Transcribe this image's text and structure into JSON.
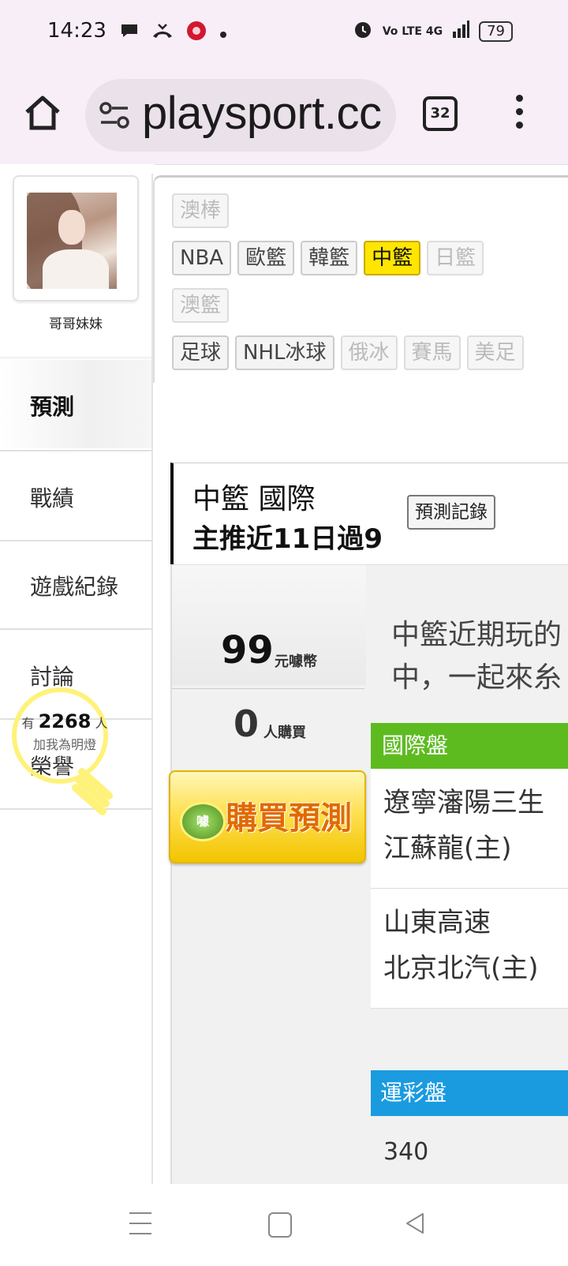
{
  "status": {
    "time": "14:23",
    "signal": "Vo LTE 4G",
    "battery": "79"
  },
  "browser": {
    "url": "playsport.cc",
    "tab_count": "32"
  },
  "user": {
    "name": "哥哥妹妹"
  },
  "nav": [
    {
      "label": "預測",
      "active": true
    },
    {
      "label": "戰績"
    },
    {
      "label": "遊戲紀錄"
    },
    {
      "label": "討論"
    },
    {
      "label": "榮譽"
    }
  ],
  "fans": {
    "prefix": "有",
    "count": "2268",
    "suffix": "人",
    "label": "加我為明燈"
  },
  "categories": {
    "row1": [
      "澳棒"
    ],
    "row2": [
      "NBA",
      "歐籃",
      "韓籃",
      "中籃",
      "日籃"
    ],
    "row3": [
      "澳籃"
    ],
    "row4": [
      "足球",
      "NHL冰球",
      "俄冰",
      "賽馬",
      "美足"
    ]
  },
  "prediction": {
    "title": "中籃 國際",
    "subtitle": "主推近11日過9",
    "record_btn": "預測記錄",
    "price": "99",
    "price_unit": "元噱幣",
    "buyers": "0",
    "buyers_unit": "人購買",
    "buy_btn": "購買預測",
    "coin": "噱",
    "desc_line1": "中籃近期玩的",
    "desc_line2": "中，一起來糸"
  },
  "market": {
    "title": "國際盤",
    "matches": [
      {
        "away": "遼寧瀋陽三生",
        "home": "江蘇龍(主)"
      },
      {
        "away": "山東高速",
        "home": "北京北汽(主)"
      }
    ]
  },
  "lottery": {
    "title": "運彩盤",
    "value": "340"
  }
}
